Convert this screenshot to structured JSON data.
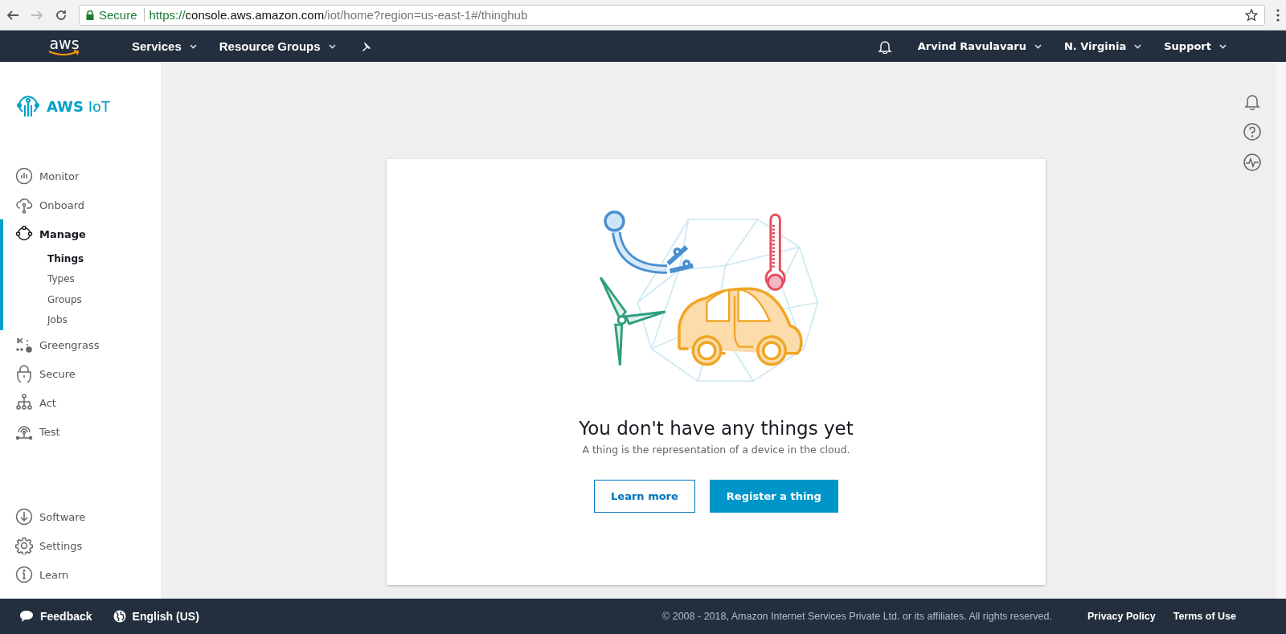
{
  "browser": {
    "security": "Secure",
    "url_scheme": "https://",
    "url_host": "console.aws.amazon.com",
    "url_path": "/iot/home?region=us-east-1#/thinghub"
  },
  "nav": {
    "logo": "aws",
    "menus": [
      {
        "label": "Services"
      },
      {
        "label": "Resource Groups"
      }
    ],
    "right_menus": [
      {
        "label": "Arvind Ravulavaru"
      },
      {
        "label": "N. Virginia"
      },
      {
        "label": "Support"
      }
    ]
  },
  "sidebar": {
    "title_bold": "AWS",
    "title_rest": "IoT",
    "items": [
      {
        "label": "Monitor",
        "selected": false
      },
      {
        "label": "Onboard",
        "selected": false
      },
      {
        "label": "Manage",
        "selected": true,
        "children": [
          {
            "label": "Things",
            "selected": true
          },
          {
            "label": "Types",
            "selected": false
          },
          {
            "label": "Groups",
            "selected": false
          },
          {
            "label": "Jobs",
            "selected": false
          }
        ]
      },
      {
        "label": "Greengrass",
        "selected": false
      },
      {
        "label": "Secure",
        "selected": false
      },
      {
        "label": "Act",
        "selected": false
      },
      {
        "label": "Test",
        "selected": false
      }
    ],
    "bottom_items": [
      {
        "label": "Software",
        "selected": false
      },
      {
        "label": "Settings",
        "selected": false
      },
      {
        "label": "Learn",
        "selected": false
      }
    ]
  },
  "empty_state": {
    "title": "You don't have any things yet",
    "description": "A thing is the representation of a device in the cloud.",
    "buttons": [
      {
        "label": "Learn more",
        "kind": "secondary"
      },
      {
        "label": "Register a thing",
        "kind": "primary"
      }
    ]
  },
  "footer": {
    "feedback": "Feedback",
    "language": "English (US)",
    "copyright": "© 2008 - 2018, Amazon Internet Services Private Ltd. or its affiliates. All rights reserved.",
    "links": [
      {
        "label": "Privacy Policy"
      },
      {
        "label": "Terms of Use"
      }
    ]
  }
}
